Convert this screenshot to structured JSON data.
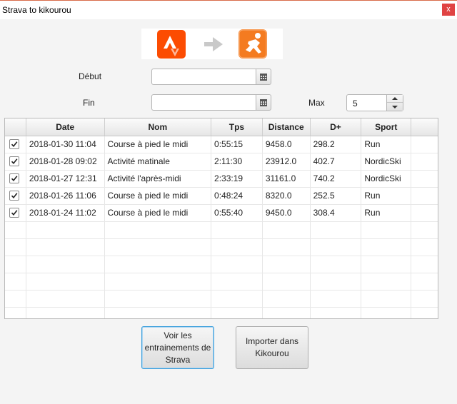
{
  "window": {
    "title": "Strava to kikourou",
    "close_label": "x"
  },
  "logos": {
    "left": "strava-logo",
    "arrow": "arrow-right-icon",
    "right": "kikourou-logo"
  },
  "form": {
    "debut_label": "Début",
    "debut_value": "",
    "fin_label": "Fin",
    "fin_value": "",
    "max_label": "Max",
    "max_value": "5"
  },
  "table": {
    "columns": [
      "",
      "Date",
      "Nom",
      "Tps",
      "Distance",
      "D+",
      "Sport",
      ""
    ],
    "rows": [
      {
        "checked": true,
        "date": "2018-01-30 11:04",
        "nom": "Course à pied le midi",
        "tps": "0:55:15",
        "distance": "9458.0",
        "dplus": "298.2",
        "sport": "Run"
      },
      {
        "checked": true,
        "date": "2018-01-28 09:02",
        "nom": "Activité matinale",
        "tps": "2:11:30",
        "distance": "23912.0",
        "dplus": "402.7",
        "sport": "NordicSki"
      },
      {
        "checked": true,
        "date": "2018-01-27 12:31",
        "nom": "Activité l'après-midi",
        "tps": "2:33:19",
        "distance": "31161.0",
        "dplus": "740.2",
        "sport": "NordicSki"
      },
      {
        "checked": true,
        "date": "2018-01-26 11:06",
        "nom": "Course à pied le midi",
        "tps": "0:48:24",
        "distance": "8320.0",
        "dplus": "252.5",
        "sport": "Run"
      },
      {
        "checked": true,
        "date": "2018-01-24 11:02",
        "nom": "Course à pied le midi",
        "tps": "0:55:40",
        "distance": "9450.0",
        "dplus": "308.4",
        "sport": "Run"
      }
    ]
  },
  "buttons": {
    "voir_label": "Voir les entrainements de Strava",
    "importer_label": "Importer dans Kikourou"
  },
  "colors": {
    "strava": "#fc4c02",
    "kikourou": "#f47b20",
    "focus": "#3c9fdc"
  }
}
